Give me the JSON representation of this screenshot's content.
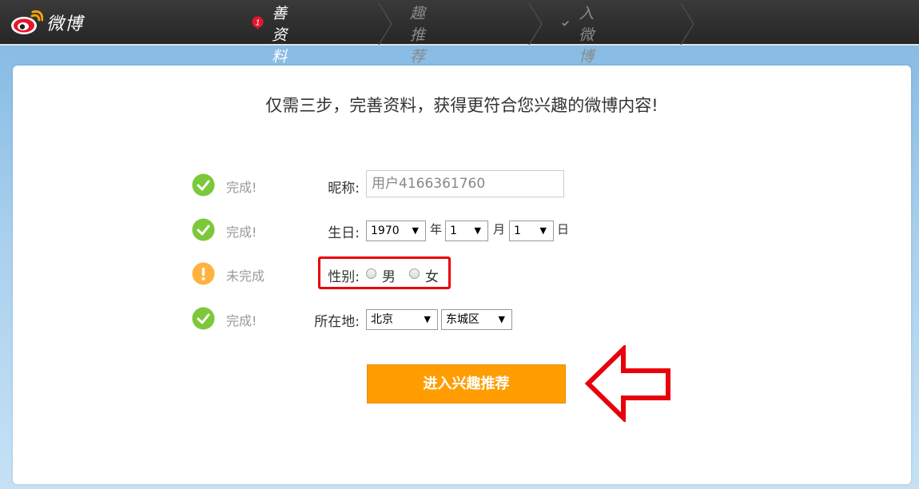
{
  "header": {
    "logo_text": "微博",
    "steps": [
      {
        "number": "1",
        "label": "完善资料",
        "state": "active"
      },
      {
        "label": "兴趣推荐",
        "state": "inactive"
      },
      {
        "label": "进入微博",
        "state": "inactive",
        "icon": "check-icon"
      }
    ]
  },
  "main": {
    "headline": "仅需三步，完善资料，获得更符合您兴趣的微博内容!",
    "rows": {
      "nickname": {
        "status": "完成!",
        "status_icon": "check-circle-icon",
        "label": "昵称:",
        "value": "用户4166361760"
      },
      "birthday": {
        "status": "完成!",
        "status_icon": "check-circle-icon",
        "label": "生日:",
        "year": "1970",
        "year_unit": "年",
        "month": "1",
        "month_unit": "月",
        "day": "1",
        "day_unit": "日"
      },
      "gender": {
        "status": "未完成",
        "status_icon": "warning-circle-icon",
        "label": "性别:",
        "male": "男",
        "female": "女"
      },
      "location": {
        "status": "完成!",
        "status_icon": "check-circle-icon",
        "label": "所在地:",
        "province": "北京",
        "district": "东城区"
      }
    },
    "submit_label": "进入兴趣推荐"
  },
  "colors": {
    "topbar": "#2b2b2b",
    "done_green": "#7cc83a",
    "warn_orange": "#ffb33e",
    "button_orange": "#ff9d00",
    "annotation_red": "#e8000c"
  }
}
